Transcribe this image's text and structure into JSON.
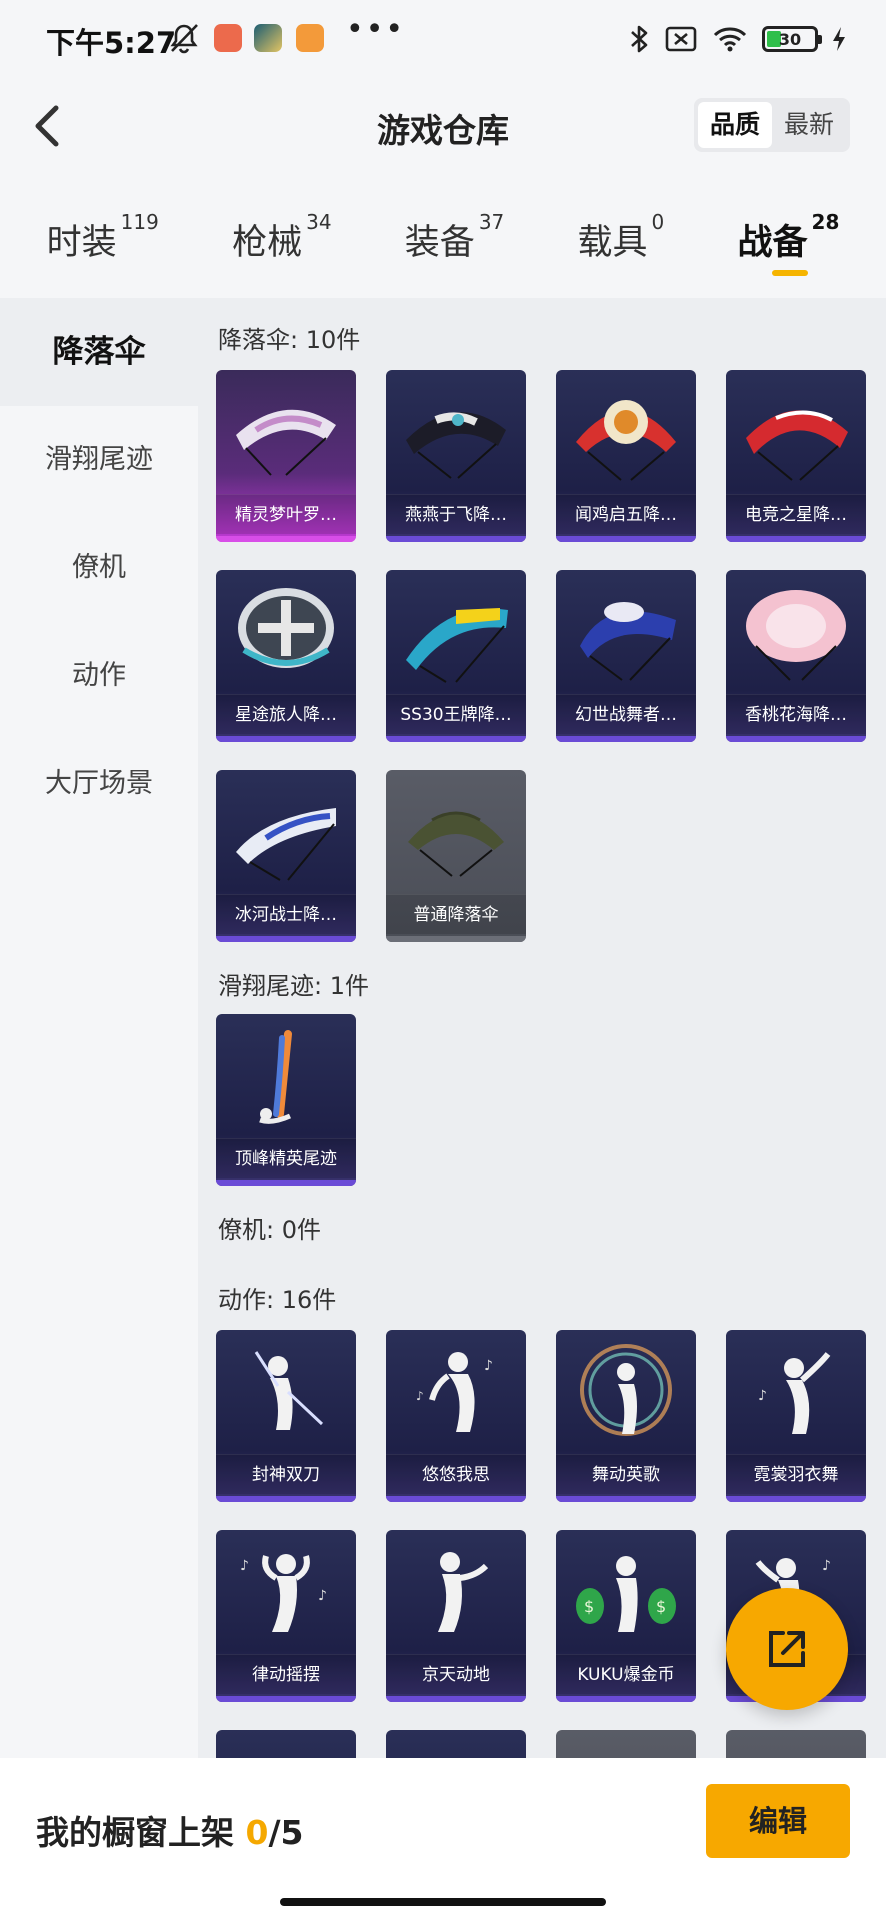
{
  "status": {
    "time": "下午5:27",
    "battery": "30"
  },
  "header": {
    "title": "游戏仓库",
    "sort": [
      "品质",
      "最新"
    ]
  },
  "tabs": [
    {
      "label": "时装",
      "count": "119"
    },
    {
      "label": "枪械",
      "count": "34"
    },
    {
      "label": "装备",
      "count": "37"
    },
    {
      "label": "载具",
      "count": "0"
    },
    {
      "label": "战备",
      "count": "28"
    }
  ],
  "sidebar": [
    "降落伞",
    "滑翔尾迹",
    "僚机",
    "动作",
    "大厅场景"
  ],
  "sections": {
    "parachute": {
      "title": "降落伞: 10件",
      "items": [
        "精灵梦叶罗…",
        "燕燕于飞降…",
        "闻鸡启五降…",
        "电竞之星降…",
        "星途旅人降…",
        "SS30王牌降…",
        "幻世战舞者…",
        "香桃花海降…",
        "冰河战士降…",
        "普通降落伞"
      ]
    },
    "trail": {
      "title": "滑翔尾迹: 1件",
      "items": [
        "顶峰精英尾迹"
      ]
    },
    "wingman": {
      "title": "僚机: 0件"
    },
    "emote": {
      "title": "动作: 16件",
      "items": [
        "封神双刀",
        "悠悠我思",
        "舞动英歌",
        "霓裳羽衣舞",
        "律动摇摆",
        "京天动地",
        "KUKU爆金币",
        ""
      ]
    }
  },
  "bottom": {
    "label": "我的橱窗上架",
    "current": "0",
    "total": "/5",
    "edit": "编辑"
  }
}
